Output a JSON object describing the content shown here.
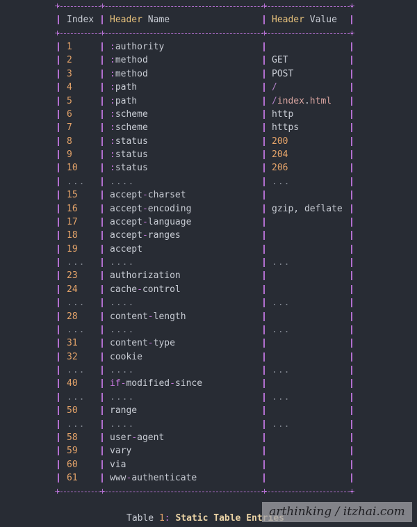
{
  "table": {
    "headers": {
      "index": "Index",
      "name_keyword": "Header",
      "name_rest": " Name",
      "value_keyword": "Header",
      "value_rest": " Value"
    },
    "rows": [
      {
        "index": "1",
        "name": ":authority",
        "value": ""
      },
      {
        "index": "2",
        "name": ":method",
        "value": "GET"
      },
      {
        "index": "3",
        "name": ":method",
        "value": "POST"
      },
      {
        "index": "4",
        "name": ":path",
        "value": "/"
      },
      {
        "index": "5",
        "name": ":path",
        "value": "/index.html"
      },
      {
        "index": "6",
        "name": ":scheme",
        "value": "http"
      },
      {
        "index": "7",
        "name": ":scheme",
        "value": "https"
      },
      {
        "index": "8",
        "name": ":status",
        "value": "200"
      },
      {
        "index": "9",
        "name": ":status",
        "value": "204"
      },
      {
        "index": "10",
        "name": ":status",
        "value": "206"
      },
      {
        "index": "...",
        "name": "....",
        "value": "..."
      },
      {
        "index": "15",
        "name": "accept-charset",
        "value": ""
      },
      {
        "index": "16",
        "name": "accept-encoding",
        "value": "gzip, deflate"
      },
      {
        "index": "17",
        "name": "accept-language",
        "value": ""
      },
      {
        "index": "18",
        "name": "accept-ranges",
        "value": ""
      },
      {
        "index": "19",
        "name": "accept",
        "value": ""
      },
      {
        "index": "...",
        "name": "....",
        "value": "..."
      },
      {
        "index": "23",
        "name": "authorization",
        "value": ""
      },
      {
        "index": "24",
        "name": "cache-control",
        "value": ""
      },
      {
        "index": "...",
        "name": "....",
        "value": "..."
      },
      {
        "index": "28",
        "name": "content-length",
        "value": ""
      },
      {
        "index": "...",
        "name": "....",
        "value": "..."
      },
      {
        "index": "31",
        "name": "content-type",
        "value": ""
      },
      {
        "index": "32",
        "name": "cookie",
        "value": ""
      },
      {
        "index": "...",
        "name": "....",
        "value": "..."
      },
      {
        "index": "40",
        "name": "if-modified-since",
        "value": ""
      },
      {
        "index": "...",
        "name": "....",
        "value": "..."
      },
      {
        "index": "50",
        "name": "range",
        "value": ""
      },
      {
        "index": "...",
        "name": "....",
        "value": "..."
      },
      {
        "index": "58",
        "name": "user-agent",
        "value": ""
      },
      {
        "index": "59",
        "name": "vary",
        "value": ""
      },
      {
        "index": "60",
        "name": "via",
        "value": ""
      },
      {
        "index": "61",
        "name": "www-authenticate",
        "value": ""
      }
    ]
  },
  "caption": {
    "prefix": "Table ",
    "number": "1",
    "colon": ":",
    "title": " Static Table Entries"
  },
  "watermark": "arthinking / itzhai.com",
  "colors": {
    "background": "#282c34",
    "border": "#b26fcf",
    "number": "#e5a46a",
    "keyword": "#c678dd",
    "header_keyword": "#e5c07b",
    "text": "#c8ccd4"
  }
}
